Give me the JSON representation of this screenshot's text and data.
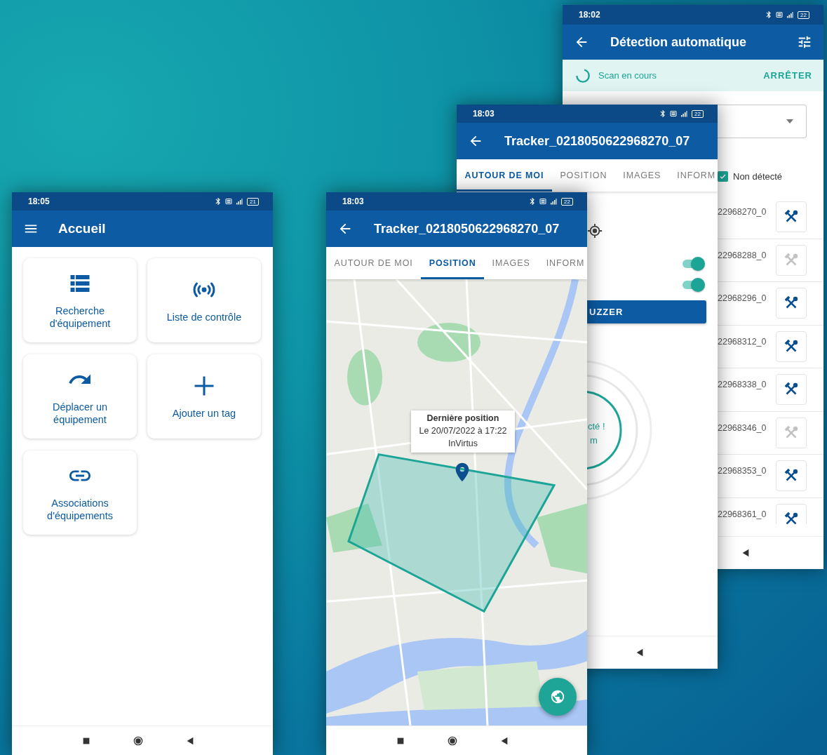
{
  "screens": [
    {
      "kind": "home",
      "status": {
        "time": "18:05",
        "battery": "21"
      },
      "title": "Accueil",
      "tiles": [
        {
          "kind": "list",
          "label": "Recherche d'équipement"
        },
        {
          "kind": "broadcast",
          "label": "Liste de contrôle"
        },
        {
          "kind": "move",
          "label": "Déplacer un équipement"
        },
        {
          "kind": "add",
          "label": "Ajouter un tag"
        },
        {
          "kind": "link",
          "label": "Associations d'équipements"
        }
      ]
    },
    {
      "kind": "position",
      "status": {
        "time": "18:03",
        "battery": "22"
      },
      "title": "Tracker_0218050622968270_07",
      "tabs": [
        {
          "label": "AUTOUR DE MOI",
          "selected": false
        },
        {
          "label": "POSITION",
          "selected": true
        },
        {
          "label": "IMAGES",
          "selected": false
        },
        {
          "label": "INFORM",
          "selected": false
        }
      ],
      "popup": {
        "title": "Dernière position",
        "date": "Le 20/07/2022 à 17:22",
        "place": "InVirtus"
      }
    },
    {
      "kind": "nearby",
      "status": {
        "time": "18:03",
        "battery": "22"
      },
      "title": "Tracker_0218050622968270_07",
      "tabs": [
        {
          "label": "AUTOUR DE MOI",
          "selected": true
        },
        {
          "label": "POSITION",
          "selected": false
        },
        {
          "label": "IMAGES",
          "selected": false
        },
        {
          "label": "INFORM",
          "selected": false
        }
      ],
      "toggles": [
        {
          "on": true
        },
        {
          "on": true
        }
      ],
      "action": "UZZER",
      "ring": [
        "cté !",
        "m"
      ]
    },
    {
      "kind": "detection",
      "status": {
        "time": "18:02",
        "battery": "22"
      },
      "title": "Détection automatique",
      "scan": {
        "label": "Scan en cours",
        "action": "ARRÊTER"
      },
      "filter": {
        "label": "Non détecté",
        "checked": true
      },
      "rows": [
        {
          "id": "22968270_0",
          "disabled": false
        },
        {
          "id": "22968288_0",
          "disabled": true
        },
        {
          "id": "22968296_0",
          "disabled": false
        },
        {
          "id": "22968312_0",
          "disabled": false
        },
        {
          "id": "22968338_0",
          "disabled": false
        },
        {
          "id": "22968346_0",
          "disabled": true
        },
        {
          "id": "22968353_0",
          "disabled": false
        },
        {
          "id": "22968361_0",
          "disabled": false
        }
      ]
    }
  ]
}
